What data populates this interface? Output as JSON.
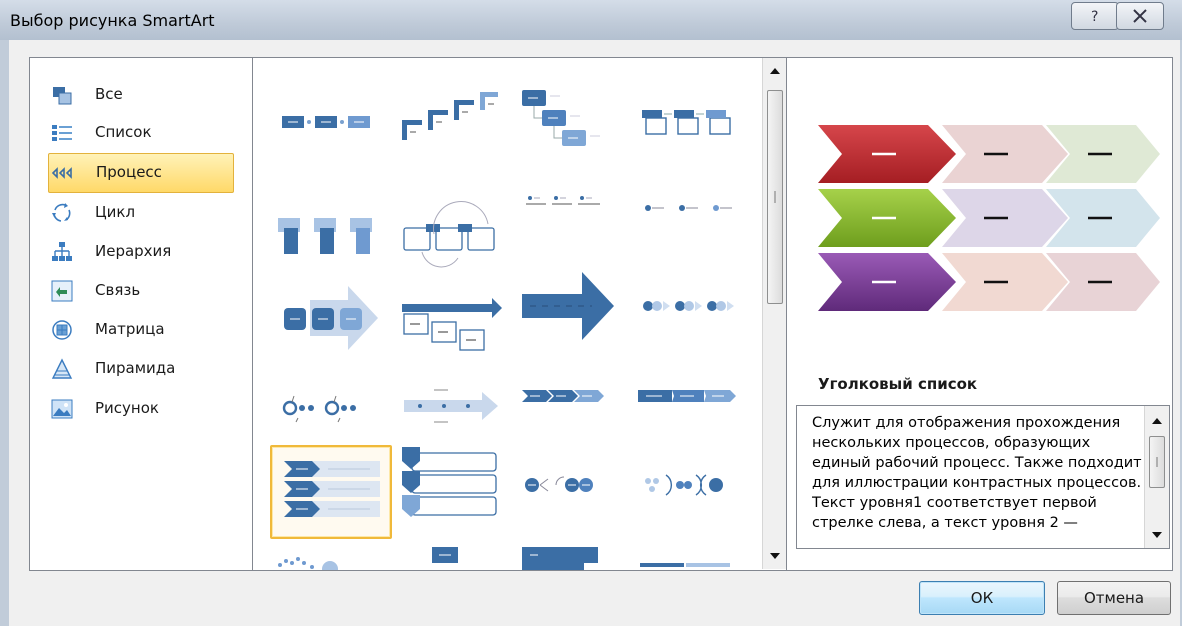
{
  "window": {
    "title": "Выбор рисунка SmartArt",
    "help_glyph": "?",
    "close_glyph": "✕"
  },
  "categories": [
    {
      "label": "Все",
      "icon": "all-icon"
    },
    {
      "label": "Список",
      "icon": "list-icon"
    },
    {
      "label": "Процесс",
      "icon": "process-icon",
      "selected": true
    },
    {
      "label": "Цикл",
      "icon": "cycle-icon"
    },
    {
      "label": "Иерархия",
      "icon": "hierarchy-icon"
    },
    {
      "label": "Связь",
      "icon": "relationship-icon"
    },
    {
      "label": "Матрица",
      "icon": "matrix-icon"
    },
    {
      "label": "Пирамида",
      "icon": "pyramid-icon"
    },
    {
      "label": "Рисунок",
      "icon": "picture-icon"
    }
  ],
  "gallery": {
    "selected_index": 16,
    "item_count": 24
  },
  "preview": {
    "title": "Уголковый список",
    "description": "Служит для отображения прохождения нескольких процессов, образующих единый рабочий процесс. Также подходит для иллюстрации контрастных процессов. Текст уровня1 соответствует первой стрелке слева, а текст уровня 2 —",
    "chevron_label": "—",
    "colors": {
      "red": "#c0272d",
      "green": "#8bbf2e",
      "purple": "#7d3c98"
    }
  },
  "buttons": {
    "ok": "ОК",
    "cancel": "Отмена"
  }
}
